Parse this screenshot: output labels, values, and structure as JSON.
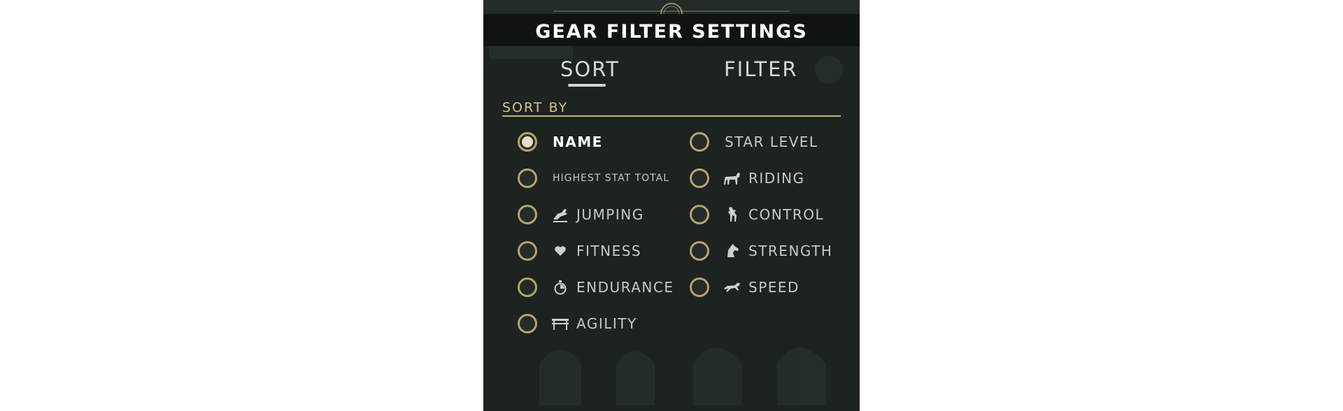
{
  "header": {
    "title": "GEAR FILTER SETTINGS"
  },
  "tabs": [
    {
      "label": "SORT",
      "active": true
    },
    {
      "label": "FILTER",
      "active": false
    }
  ],
  "section": {
    "label": "SORT BY"
  },
  "sort_options": {
    "name": {
      "label": "NAME",
      "selected": true
    },
    "star_level": {
      "label": "STAR LEVEL",
      "selected": false
    },
    "highest_stat_total": {
      "label": "HIGHEST STAT TOTAL",
      "selected": false
    },
    "riding": {
      "label": "RIDING",
      "icon": "horse-walking-icon",
      "selected": false
    },
    "jumping": {
      "label": "JUMPING",
      "icon": "horse-jumping-icon",
      "selected": false
    },
    "control": {
      "label": "CONTROL",
      "icon": "horse-rearing-icon",
      "selected": false
    },
    "fitness": {
      "label": "FITNESS",
      "icon": "heart-icon",
      "selected": false
    },
    "strength": {
      "label": "STRENGTH",
      "icon": "horse-head-icon",
      "selected": false
    },
    "endurance": {
      "label": "ENDURANCE",
      "icon": "stopwatch-icon",
      "selected": false
    },
    "speed": {
      "label": "SPEED",
      "icon": "horse-galloping-icon",
      "selected": false
    },
    "agility": {
      "label": "AGILITY",
      "icon": "fence-icon",
      "selected": false
    }
  },
  "colors": {
    "panel_bg": "#1c2321",
    "accent_gold": "#c9b27a",
    "text_light": "#c9c9c4"
  }
}
